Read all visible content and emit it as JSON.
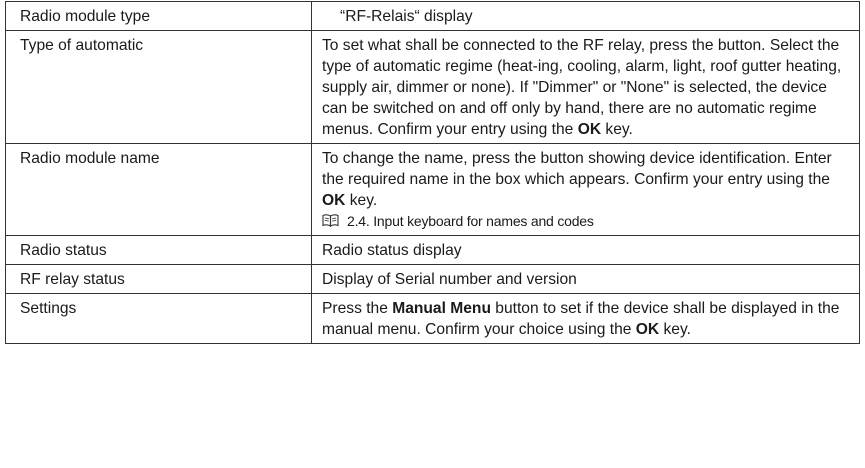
{
  "rows": [
    {
      "label": "Radio module type",
      "value": "“RF-Relais“ display"
    },
    {
      "label": "Type of automatic",
      "value": "To set what shall be connected to the RF relay, press the button. Select the type of automatic regime (heat-ing, cooling, alarm, light, roof gutter heating, supply air, dimmer or none). If \"Dimmer\" or \"None\" is selected, the device can be switched on and off only by hand, there are no automatic regime menus. Confirm your entry using the ",
      "key": "OK",
      "suffix": " key."
    },
    {
      "label": "Radio module name",
      "value": "To change the name, press the button showing device identification. Enter the required name in the box which appears. Confirm your entry using the ",
      "key": "OK",
      "suffix": " key.",
      "reference": "2.4. Input keyboard for names and codes",
      "reference_icon": "book-icon"
    },
    {
      "label": "Radio status",
      "value": "Radio status display"
    },
    {
      "label": "RF relay status",
      "value": "Display of Serial number and version"
    },
    {
      "label": "Settings",
      "prefix": "Press the ",
      "button": "Manual Menu",
      "value": " button to set if the device shall be displayed in the manual menu. Confirm your choice using the ",
      "key": "OK",
      "suffix": " key."
    }
  ]
}
